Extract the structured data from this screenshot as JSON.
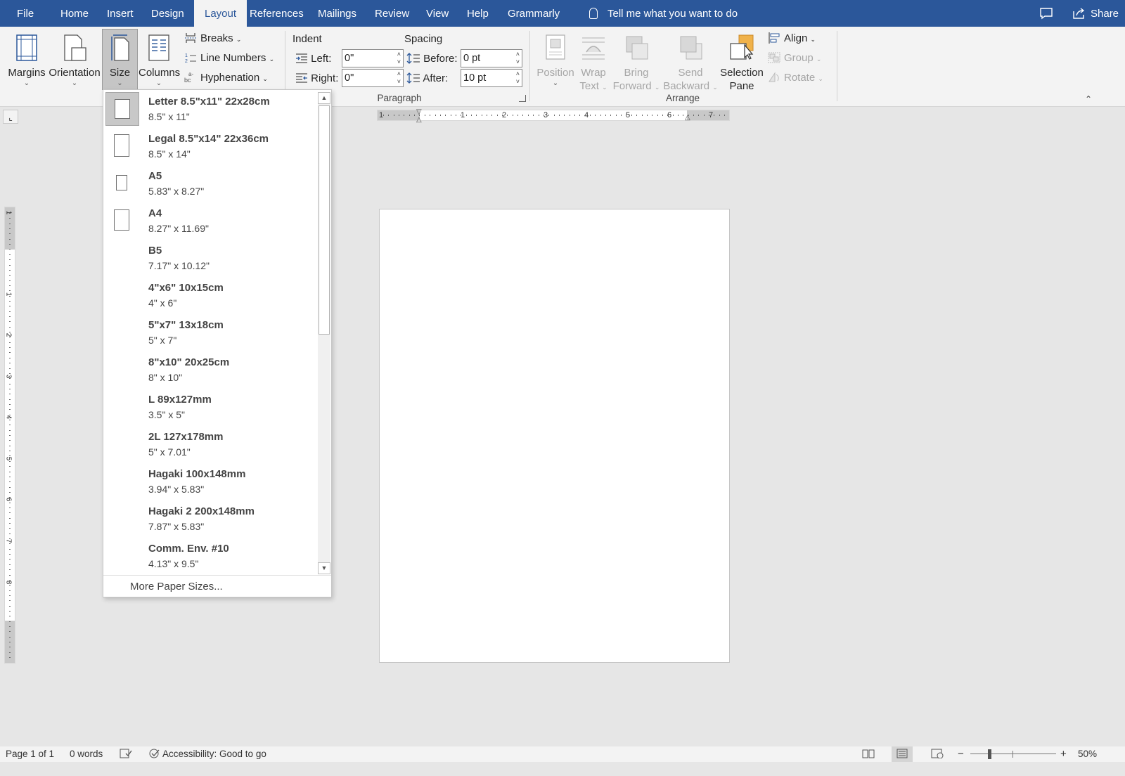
{
  "tabs": {
    "file": "File",
    "home": "Home",
    "insert": "Insert",
    "design": "Design",
    "layout": "Layout",
    "references": "References",
    "mailings": "Mailings",
    "review": "Review",
    "view": "View",
    "help": "Help",
    "grammarly": "Grammarly"
  },
  "tell_me": "Tell me what you want to do",
  "share": "Share",
  "ribbon": {
    "margins": "Margins",
    "orientation": "Orientation",
    "size": "Size",
    "columns": "Columns",
    "breaks": "Breaks",
    "line_numbers": "Line Numbers",
    "hyphenation": "Hyphenation",
    "indent_title": "Indent",
    "spacing_title": "Spacing",
    "left_label": "Left:",
    "right_label": "Right:",
    "before_label": "Before:",
    "after_label": "After:",
    "indent_left": "0\"",
    "indent_right": "0\"",
    "spacing_before": "0 pt",
    "spacing_after": "10 pt",
    "paragraph_group": "Paragraph",
    "position_l1": "Position",
    "wrap_l1": "Wrap",
    "wrap_l2": "Text",
    "bring_l1": "Bring",
    "bring_l2": "Forward",
    "send_l1": "Send",
    "send_l2": "Backward",
    "selection_l1": "Selection",
    "selection_l2": "Pane",
    "align": "Align",
    "group": "Group",
    "rotate": "Rotate",
    "arrange_group": "Arrange"
  },
  "size_menu": {
    "items": [
      {
        "name": "Letter 8.5\"x11\" 22x28cm",
        "dims": "8.5\" x 11\""
      },
      {
        "name": "Legal 8.5\"x14\" 22x36cm",
        "dims": "8.5\" x 14\""
      },
      {
        "name": "A5",
        "dims": "5.83\" x 8.27\""
      },
      {
        "name": "A4",
        "dims": "8.27\" x 11.69\""
      },
      {
        "name": "B5",
        "dims": "7.17\" x 10.12\""
      },
      {
        "name": "4\"x6\" 10x15cm",
        "dims": "4\" x 6\""
      },
      {
        "name": "5\"x7\" 13x18cm",
        "dims": "5\" x 7\""
      },
      {
        "name": "8\"x10\" 20x25cm",
        "dims": "8\" x 10\""
      },
      {
        "name": "L 89x127mm",
        "dims": "3.5\" x 5\""
      },
      {
        "name": "2L 127x178mm",
        "dims": "5\" x 7.01\""
      },
      {
        "name": "Hagaki 100x148mm",
        "dims": "3.94\" x 5.83\""
      },
      {
        "name": "Hagaki 2 200x148mm",
        "dims": "7.87\" x 5.83\""
      },
      {
        "name": "Comm. Env. #10",
        "dims": "4.13\" x 9.5\""
      }
    ],
    "selected_index": 0,
    "more": "More Paper Sizes..."
  },
  "ruler": {
    "h_numbers": [
      "1",
      "1",
      "2",
      "3",
      "4",
      "5",
      "6",
      "7"
    ],
    "v_numbers": [
      "1",
      "1",
      "2",
      "3",
      "4",
      "5",
      "6",
      "7",
      "8"
    ]
  },
  "status": {
    "page": "Page 1 of 1",
    "words": "0 words",
    "accessibility": "Accessibility: Good to go",
    "zoom": "50%",
    "zoom_minus": "−",
    "zoom_plus": "+"
  },
  "colors": {
    "title_bar": "#2b579a",
    "ribbon_bg": "#f3f3f3",
    "canvas_bg": "#e6e6e6",
    "accent_orange": "#f0b24a"
  }
}
